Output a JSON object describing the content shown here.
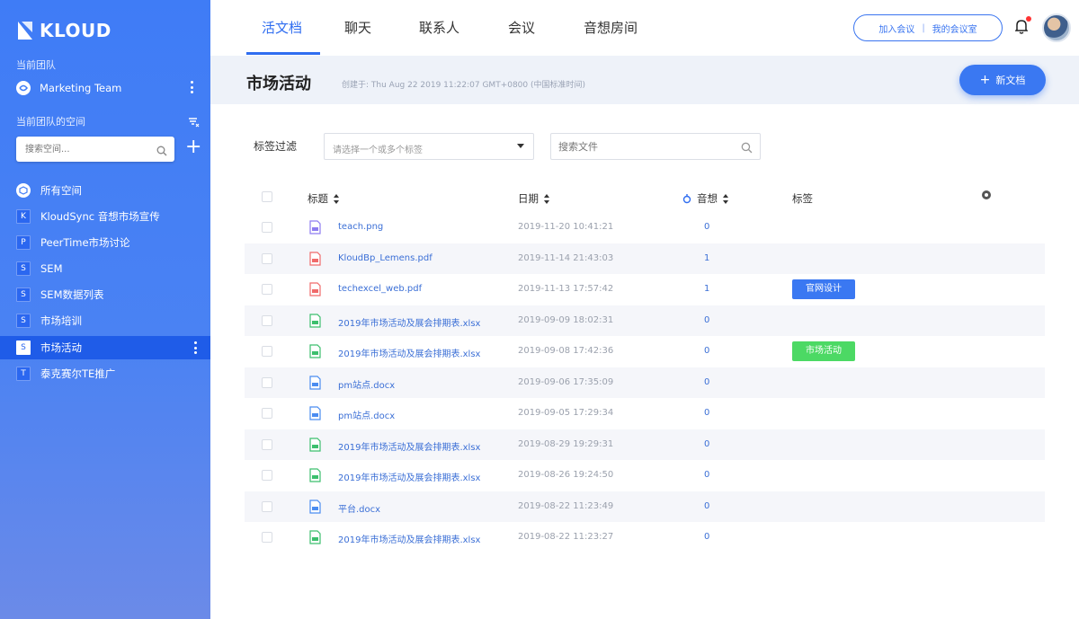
{
  "app": {
    "logo_text": "KLOUD"
  },
  "sidebar": {
    "current_team_label": "当前团队",
    "team_name": "Marketing Team",
    "team_spaces_label": "当前团队的空间",
    "search_placeholder": "搜索空间...",
    "items": [
      {
        "badge": "",
        "label": "所有空间",
        "active": false
      },
      {
        "badge": "K",
        "label": "KloudSync 音想市场宣传",
        "active": false
      },
      {
        "badge": "P",
        "label": "PeerTime市场讨论",
        "active": false
      },
      {
        "badge": "S",
        "label": "SEM",
        "active": false
      },
      {
        "badge": "S",
        "label": "SEM数据列表",
        "active": false
      },
      {
        "badge": "S",
        "label": "市场培训",
        "active": false
      },
      {
        "badge": "S",
        "label": "市场活动",
        "active": true
      },
      {
        "badge": "T",
        "label": "泰克赛尔TE推广",
        "active": false
      }
    ]
  },
  "topnav": {
    "tabs": [
      "活文档",
      "聊天",
      "联系人",
      "会议",
      "音想房间"
    ],
    "active_tab": 0,
    "join_meeting": "加入会议",
    "my_meeting_room": "我的会议室"
  },
  "header": {
    "title": "市场活动",
    "created": "创建于: Thu Aug 22 2019 11:22:07 GMT+0800 (中国标准时间)",
    "new_doc_label": "新文档"
  },
  "filter": {
    "label": "标签过滤",
    "tag_placeholder": "请选择一个或多个标签",
    "file_search_placeholder": "搜索文件"
  },
  "table": {
    "headers": {
      "title": "标题",
      "date": "日期",
      "views": "音想",
      "tags": "标签"
    },
    "rows": [
      {
        "icon": "image-file-icon",
        "name": "teach.png",
        "date": "2019-11-20 10:41:21",
        "views": "0",
        "tag": "",
        "tag_color": ""
      },
      {
        "icon": "pdf-file-icon",
        "name": "KloudBp_Lemens.pdf",
        "date": "2019-11-14 21:43:03",
        "views": "1",
        "tag": "",
        "tag_color": ""
      },
      {
        "icon": "pdf-file-icon",
        "name": "techexcel_web.pdf",
        "date": "2019-11-13 17:57:42",
        "views": "1",
        "tag": "官网设计",
        "tag_color": "#3a78f2"
      },
      {
        "icon": "excel-file-icon",
        "name": "2019年市场活动及展会排期表.xlsx",
        "date": "2019-09-09 18:02:31",
        "views": "0",
        "tag": "",
        "tag_color": ""
      },
      {
        "icon": "excel-file-icon",
        "name": "2019年市场活动及展会排期表.xlsx",
        "date": "2019-09-08 17:42:36",
        "views": "0",
        "tag": "市场活动",
        "tag_color": "#4cd964"
      },
      {
        "icon": "word-file-icon",
        "name": "pm站点.docx",
        "date": "2019-09-06 17:35:09",
        "views": "0",
        "tag": "",
        "tag_color": ""
      },
      {
        "icon": "word-file-icon",
        "name": "pm站点.docx",
        "date": "2019-09-05 17:29:34",
        "views": "0",
        "tag": "",
        "tag_color": ""
      },
      {
        "icon": "excel-file-icon",
        "name": "2019年市场活动及展会排期表.xlsx",
        "date": "2019-08-29 19:29:31",
        "views": "0",
        "tag": "",
        "tag_color": ""
      },
      {
        "icon": "excel-file-icon",
        "name": "2019年市场活动及展会排期表.xlsx",
        "date": "2019-08-26 19:24:50",
        "views": "0",
        "tag": "",
        "tag_color": ""
      },
      {
        "icon": "word-file-icon",
        "name": "平台.docx",
        "date": "2019-08-22 11:23:49",
        "views": "0",
        "tag": "",
        "tag_color": ""
      },
      {
        "icon": "excel-file-icon",
        "name": "2019年市场活动及展会排期表.xlsx",
        "date": "2019-08-22 11:23:27",
        "views": "0",
        "tag": "",
        "tag_color": ""
      }
    ]
  },
  "colors": {
    "accent": "#2f6df0",
    "sidebar_active": "#1f5ce8",
    "link": "#3b6fd6",
    "tag_blue": "#3a78f2",
    "tag_green": "#4cd964"
  }
}
